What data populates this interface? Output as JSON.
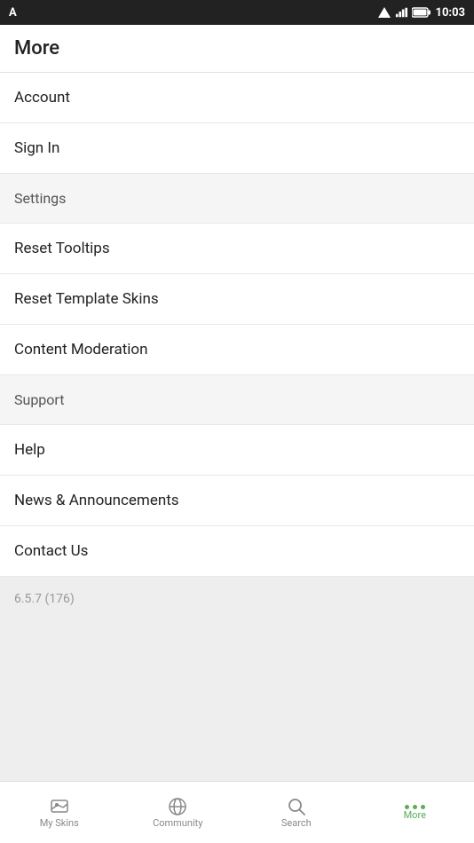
{
  "statusBar": {
    "time": "10:03",
    "appIcon": "A"
  },
  "pageTitle": "More",
  "menuItems": [
    {
      "id": "account",
      "label": "Account",
      "isSection": false
    },
    {
      "id": "sign-in",
      "label": "Sign In",
      "isSection": false
    },
    {
      "id": "settings",
      "label": "Settings",
      "isSection": true
    },
    {
      "id": "reset-tooltips",
      "label": "Reset Tooltips",
      "isSection": false
    },
    {
      "id": "reset-template-skins",
      "label": "Reset Template Skins",
      "isSection": false
    },
    {
      "id": "content-moderation",
      "label": "Content Moderation",
      "isSection": false
    },
    {
      "id": "support",
      "label": "Support",
      "isSection": true
    },
    {
      "id": "help",
      "label": "Help",
      "isSection": false
    },
    {
      "id": "news-announcements",
      "label": "News & Announcements",
      "isSection": false
    },
    {
      "id": "contact-us",
      "label": "Contact Us",
      "isSection": false
    }
  ],
  "version": "6.5.7 (176)",
  "bottomNav": {
    "items": [
      {
        "id": "my-skins",
        "label": "My Skins",
        "iconType": "skins",
        "active": false
      },
      {
        "id": "community",
        "label": "Community",
        "iconType": "community",
        "active": false
      },
      {
        "id": "search",
        "label": "Search",
        "iconType": "search",
        "active": false
      },
      {
        "id": "more",
        "label": "More",
        "iconType": "more",
        "active": true
      }
    ]
  }
}
